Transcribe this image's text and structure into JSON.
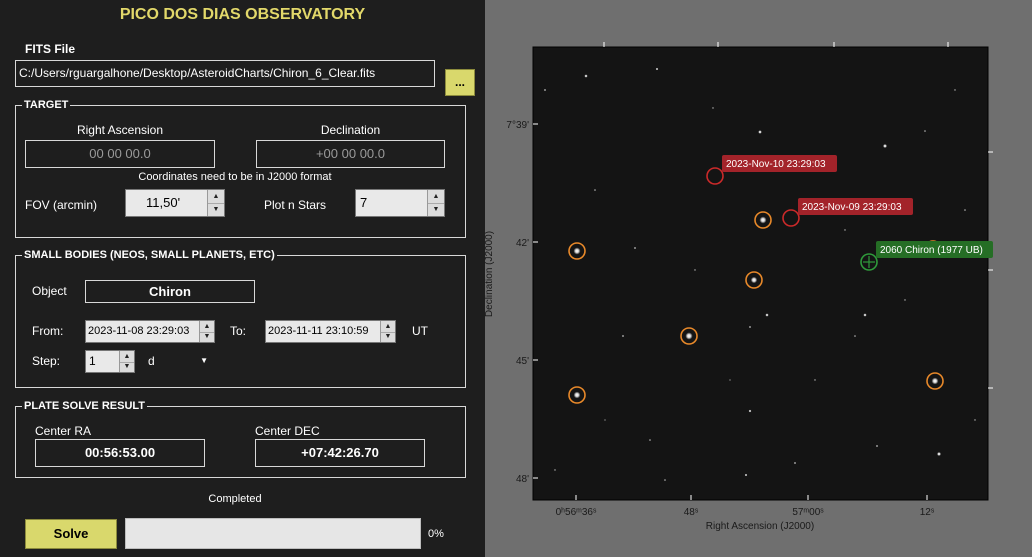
{
  "app": {
    "title": "PICO DOS DIAS OBSERVATORY"
  },
  "fits": {
    "label": "FITS File",
    "path": "C:/Users/rguargalhone/Desktop/AsteroidCharts/Chiron_6_Clear.fits",
    "browse_label": "..."
  },
  "target": {
    "legend": "TARGET",
    "ra_label": "Right Ascension",
    "dec_label": "Declination",
    "ra_placeholder": "00 00 00.0",
    "dec_placeholder": "+00 00 00.0",
    "note": "Coordinates need to be in J2000 format",
    "fov_label": "FOV (arcmin)",
    "fov_value": "11,50'",
    "plot_label": "Plot n Stars",
    "plot_value": "7"
  },
  "small_bodies": {
    "legend": "SMALL BODIES (NEOS, SMALL PLANETS, ETC)",
    "object_label": "Object",
    "object_value": "Chiron",
    "from_label": "From:",
    "from_value": "2023-11-08 23:29:03",
    "to_label": "To:",
    "to_value": "2023-11-11 23:10:59",
    "ut_label": "UT",
    "step_label": "Step:",
    "step_value": "1",
    "step_unit": "d"
  },
  "plate_solve": {
    "legend": "PLATE SOLVE RESULT",
    "ra_label": "Center RA",
    "ra_value": "00:56:53.00",
    "dec_label": "Center DEC",
    "dec_value": "+07:42:26.70"
  },
  "status": {
    "text": "Completed",
    "solve_label": "Solve",
    "progress_text": "0%",
    "progress": 0
  },
  "chart": {
    "xlabel": "Right Ascension (J2000)",
    "ylabel": "Declination (J2000)",
    "x_ticks": [
      "0ʰ56ᵐ36ˢ",
      "48ˢ",
      "57ᵐ00ˢ",
      "12ˢ"
    ],
    "y_ticks": [
      "7°39'",
      "42'",
      "45'",
      "48'"
    ],
    "annotations": {
      "pos1": "2023-Nov-10 23:29:03",
      "pos2": "2023-Nov-09 23:29:03",
      "target": "2060 Chiron (1977 UB)"
    },
    "colors": {
      "marker_orange": "#e8892a",
      "marker_red": "#cc2a2a",
      "marker_green": "#2f9a3b",
      "label_red": "#a3232a",
      "label_green": "#256e25"
    }
  }
}
